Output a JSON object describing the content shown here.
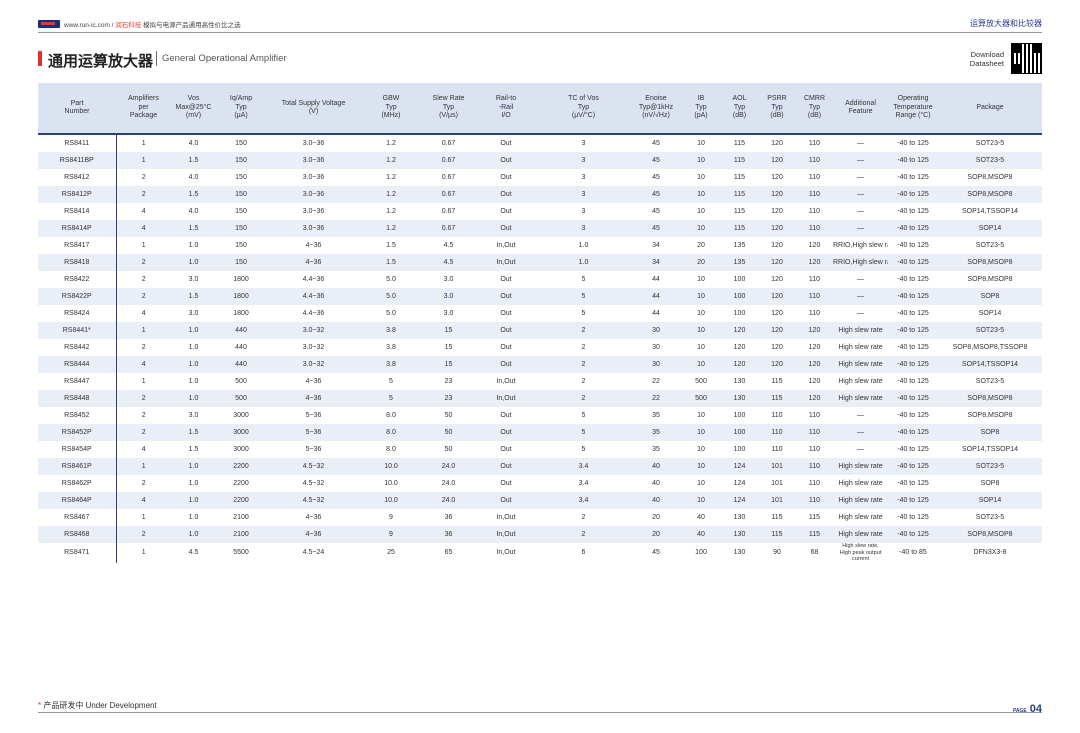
{
  "header": {
    "site_prefix": "www.run-ic.com / ",
    "site_brand": "润石科技",
    "site_suffix": " 模拟与电源产品通用高性价比之选",
    "section": "运算放大器和比较器"
  },
  "title": {
    "cn": "通用运算放大器",
    "en": "General Operational Amplifier"
  },
  "download": {
    "line1": "Download",
    "line2": "Datasheet"
  },
  "table": {
    "headers": [
      "Part\nNumber",
      "Amplifiers\nper\nPackage",
      "Vos\nMax@25°C\n(mV)",
      "Iq/Amp\nTyp\n(μA)",
      "Total Supply Voltage\n(V)",
      "GBW\nTyp\n(MHz)",
      "Slew Rate\nTyp\n(V/μs)",
      "Rail-to\n-Rail\nI/O",
      "TC of Vos\nTyp\n(μV/°C)",
      "Enoise\nTyp@1kHz\n(nV/√Hz)",
      "IB\nTyp\n(pA)",
      "AOL\nTyp\n(dB)",
      "PSRR\nTyp\n(dB)",
      "CMRR\nTyp\n(dB)",
      "Additional\nFeature",
      "Operating\nTemperature\nRange (°C)",
      "Package"
    ],
    "rows": [
      [
        "RS8411",
        "1",
        "4.0",
        "150",
        "3.0~36",
        "1.2",
        "0.67",
        "Out",
        "3",
        "45",
        "10",
        "115",
        "120",
        "110",
        "—",
        "-40 to 125",
        "SOT23-5"
      ],
      [
        "RS8411BP",
        "1",
        "1.5",
        "150",
        "3.0~36",
        "1.2",
        "0.67",
        "Out",
        "3",
        "45",
        "10",
        "115",
        "120",
        "110",
        "—",
        "-40 to 125",
        "SOT23-5"
      ],
      [
        "RS8412",
        "2",
        "4.0",
        "150",
        "3.0~36",
        "1.2",
        "0.67",
        "Out",
        "3",
        "45",
        "10",
        "115",
        "120",
        "110",
        "—",
        "-40 to 125",
        "SOP8,MSOP8"
      ],
      [
        "RS8412P",
        "2",
        "1.5",
        "150",
        "3.0~36",
        "1.2",
        "0.67",
        "Out",
        "3",
        "45",
        "10",
        "115",
        "120",
        "110",
        "—",
        "-40 to 125",
        "SOP8,MSOP8"
      ],
      [
        "RS8414",
        "4",
        "4.0",
        "150",
        "3.0~36",
        "1.2",
        "0.67",
        "Out",
        "3",
        "45",
        "10",
        "115",
        "120",
        "110",
        "—",
        "-40 to 125",
        "SOP14,TSSOP14"
      ],
      [
        "RS8414P",
        "4",
        "1.5",
        "150",
        "3.0~36",
        "1.2",
        "0.67",
        "Out",
        "3",
        "45",
        "10",
        "115",
        "120",
        "110",
        "—",
        "-40 to 125",
        "SOP14"
      ],
      [
        "RS8417",
        "1",
        "1.0",
        "150",
        "4~36",
        "1.5",
        "4.5",
        "In,Out",
        "1.0",
        "34",
        "20",
        "135",
        "120",
        "120",
        "RRIO,High slew rate",
        "-40 to 125",
        "SOT23-5"
      ],
      [
        "RS8418",
        "2",
        "1.0",
        "150",
        "4~36",
        "1.5",
        "4.5",
        "In,Out",
        "1.0",
        "34",
        "20",
        "135",
        "120",
        "120",
        "RRIO,High slew rate",
        "-40 to 125",
        "SOP8,MSOP8"
      ],
      [
        "RS8422",
        "2",
        "3.0",
        "1800",
        "4.4~36",
        "5.0",
        "3.0",
        "Out",
        "5",
        "44",
        "10",
        "100",
        "120",
        "110",
        "—",
        "-40 to 125",
        "SOP8,MSOP8"
      ],
      [
        "RS8422P",
        "2",
        "1.5",
        "1800",
        "4.4~36",
        "5.0",
        "3.0",
        "Out",
        "5",
        "44",
        "10",
        "100",
        "120",
        "110",
        "—",
        "-40 to 125",
        "SOP8"
      ],
      [
        "RS8424",
        "4",
        "3.0",
        "1800",
        "4.4~36",
        "5.0",
        "3.0",
        "Out",
        "5",
        "44",
        "10",
        "100",
        "120",
        "110",
        "—",
        "-40 to 125",
        "SOP14"
      ],
      [
        "RS8441*",
        "1",
        "1.0",
        "440",
        "3.0~32",
        "3.8",
        "15",
        "Out",
        "2",
        "30",
        "10",
        "120",
        "120",
        "120",
        "High slew rate",
        "-40 to 125",
        "SOT23-5"
      ],
      [
        "RS8442",
        "2",
        "1.0",
        "440",
        "3.0~32",
        "3.8",
        "15",
        "Out",
        "2",
        "30",
        "10",
        "120",
        "120",
        "120",
        "High slew rate",
        "-40 to 125",
        "SOP8,MSOP8,TSSOP8"
      ],
      [
        "RS8444",
        "4",
        "1.0",
        "440",
        "3.0~32",
        "3.8",
        "15",
        "Out",
        "2",
        "30",
        "10",
        "120",
        "120",
        "120",
        "High slew rate",
        "-40 to 125",
        "SOP14,TSSOP14"
      ],
      [
        "RS8447",
        "1",
        "1.0",
        "500",
        "4~36",
        "5",
        "23",
        "In,Out",
        "2",
        "22",
        "500",
        "130",
        "115",
        "120",
        "High slew rate",
        "-40 to 125",
        "SOT23-5"
      ],
      [
        "RS8448",
        "2",
        "1.0",
        "500",
        "4~36",
        "5",
        "23",
        "In,Out",
        "2",
        "22",
        "500",
        "130",
        "115",
        "120",
        "High slew rate",
        "-40 to 125",
        "SOP8,MSOP8"
      ],
      [
        "RS8452",
        "2",
        "3.0",
        "3000",
        "5~36",
        "8.0",
        "50",
        "Out",
        "5",
        "35",
        "10",
        "100",
        "110",
        "110",
        "—",
        "-40 to 125",
        "SOP8,MSOP8"
      ],
      [
        "RS8452P",
        "2",
        "1.5",
        "3000",
        "5~36",
        "8.0",
        "50",
        "Out",
        "5",
        "35",
        "10",
        "100",
        "110",
        "110",
        "—",
        "-40 to 125",
        "SOP8"
      ],
      [
        "RS8454P",
        "4",
        "1.5",
        "3000",
        "5~36",
        "8.0",
        "50",
        "Out",
        "5",
        "35",
        "10",
        "100",
        "110",
        "110",
        "—",
        "-40 to 125",
        "SOP14,TSSOP14"
      ],
      [
        "RS8461P",
        "1",
        "1.0",
        "2200",
        "4.5~32",
        "10.0",
        "24.0",
        "Out",
        "3.4",
        "40",
        "10",
        "124",
        "101",
        "110",
        "High slew rate",
        "-40 to 125",
        "SOT23-5"
      ],
      [
        "RS8462P",
        "2",
        "1.0",
        "2200",
        "4.5~32",
        "10.0",
        "24.0",
        "Out",
        "3.4",
        "40",
        "10",
        "124",
        "101",
        "110",
        "High slew rate",
        "-40 to 125",
        "SOP8"
      ],
      [
        "RS8464P",
        "4",
        "1.0",
        "2200",
        "4.5~32",
        "10.0",
        "24.0",
        "Out",
        "3.4",
        "40",
        "10",
        "124",
        "101",
        "110",
        "High slew rate",
        "-40 to 125",
        "SOP14"
      ],
      [
        "RS8467",
        "1",
        "1.0",
        "2100",
        "4~36",
        "9",
        "36",
        "In,Out",
        "2",
        "20",
        "40",
        "130",
        "115",
        "115",
        "High slew rate",
        "-40 to 125",
        "SOT23-5"
      ],
      [
        "RS8468",
        "2",
        "1.0",
        "2100",
        "4~36",
        "9",
        "36",
        "In,Out",
        "2",
        "20",
        "40",
        "130",
        "115",
        "115",
        "High slew rate",
        "-40 to 125",
        "SOP8,MSOP8"
      ],
      [
        "RS8471",
        "1",
        "4.5",
        "5500",
        "4.5~24",
        "25",
        "65",
        "In,Out",
        "6",
        "45",
        "100",
        "130",
        "90",
        "68",
        "High slew rate,\nHigh peak output current",
        "-40 to 85",
        "DFN3X3-8"
      ]
    ]
  },
  "footer": {
    "star": "*",
    "note": " 产品研发中 Under Development",
    "page_label": "PAGE",
    "page_number": "04"
  }
}
